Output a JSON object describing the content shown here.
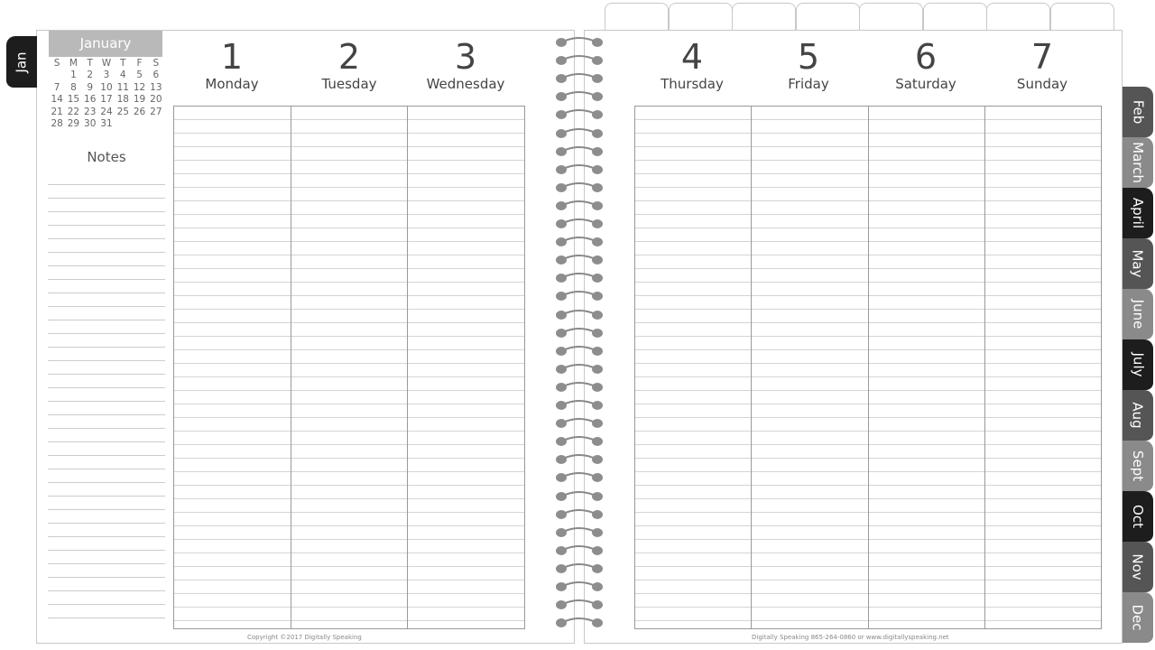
{
  "side_tab": "Jan",
  "month_tabs": [
    {
      "label": "Feb",
      "color": "#555555"
    },
    {
      "label": "March",
      "color": "#8a8a8a"
    },
    {
      "label": "April",
      "color": "#1d1d1d"
    },
    {
      "label": "May",
      "color": "#555555"
    },
    {
      "label": "June",
      "color": "#8a8a8a"
    },
    {
      "label": "July",
      "color": "#1d1d1d"
    },
    {
      "label": "Aug",
      "color": "#555555"
    },
    {
      "label": "Sept",
      "color": "#8a8a8a"
    },
    {
      "label": "Oct",
      "color": "#1d1d1d"
    },
    {
      "label": "Nov",
      "color": "#555555"
    },
    {
      "label": "Dec",
      "color": "#8a8a8a"
    }
  ],
  "mini_calendar": {
    "title": "January",
    "weekdays": [
      "S",
      "M",
      "T",
      "W",
      "T",
      "F",
      "S"
    ],
    "weeks": [
      [
        "",
        "1",
        "2",
        "3",
        "4",
        "5",
        "6"
      ],
      [
        "7",
        "8",
        "9",
        "10",
        "11",
        "12",
        "13"
      ],
      [
        "14",
        "15",
        "16",
        "17",
        "18",
        "19",
        "20"
      ],
      [
        "21",
        "22",
        "23",
        "24",
        "25",
        "26",
        "27"
      ],
      [
        "28",
        "29",
        "30",
        "31",
        "",
        "",
        ""
      ]
    ]
  },
  "notes_title": "Notes",
  "days": [
    {
      "num": "1",
      "name": "Monday"
    },
    {
      "num": "2",
      "name": "Tuesday"
    },
    {
      "num": "3",
      "name": "Wednesday"
    },
    {
      "num": "4",
      "name": "Thursday"
    },
    {
      "num": "5",
      "name": "Friday"
    },
    {
      "num": "6",
      "name": "Saturday"
    },
    {
      "num": "7",
      "name": "Sunday"
    }
  ],
  "footer_left": "Copyright ©2017 Digitally Speaking",
  "footer_right": "Digitally Speaking 865-264-0860 or www.digitallyspeaking.net"
}
